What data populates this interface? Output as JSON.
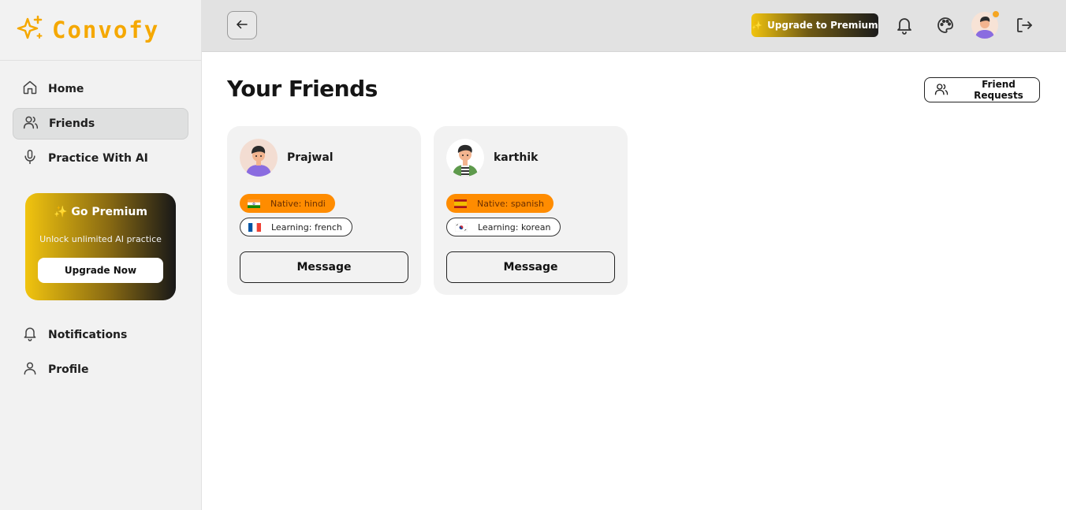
{
  "brand": {
    "name": "Convofy",
    "accent": "#f5a800"
  },
  "sidebar": {
    "items": [
      {
        "label": "Home",
        "icon": "home-icon"
      },
      {
        "label": "Friends",
        "icon": "users-icon",
        "active": true
      },
      {
        "label": "Practice With AI",
        "icon": "mic-icon"
      }
    ],
    "premium": {
      "title": "✨ Go Premium",
      "subtitle": "Unlock unlimited AI practice",
      "button": "Upgrade Now"
    },
    "bottom_items": [
      {
        "label": "Notifications",
        "icon": "bell-icon"
      },
      {
        "label": "Profile",
        "icon": "user-icon"
      }
    ]
  },
  "header": {
    "upgrade_label": "Upgrade to Premium",
    "upgrade_spark": "✨"
  },
  "main": {
    "title": "Your Friends",
    "friend_requests_label": "Friend Requests",
    "friends": [
      {
        "name": "Prajwal",
        "native": "Native: hindi",
        "native_flag": "india-flag",
        "learning": "Learning: french",
        "learning_flag": "france-flag",
        "message_label": "Message"
      },
      {
        "name": "karthik",
        "native": "Native: spanish",
        "native_flag": "spain-flag",
        "learning": "Learning: korean",
        "learning_flag": "korea-flag",
        "message_label": "Message"
      }
    ]
  }
}
